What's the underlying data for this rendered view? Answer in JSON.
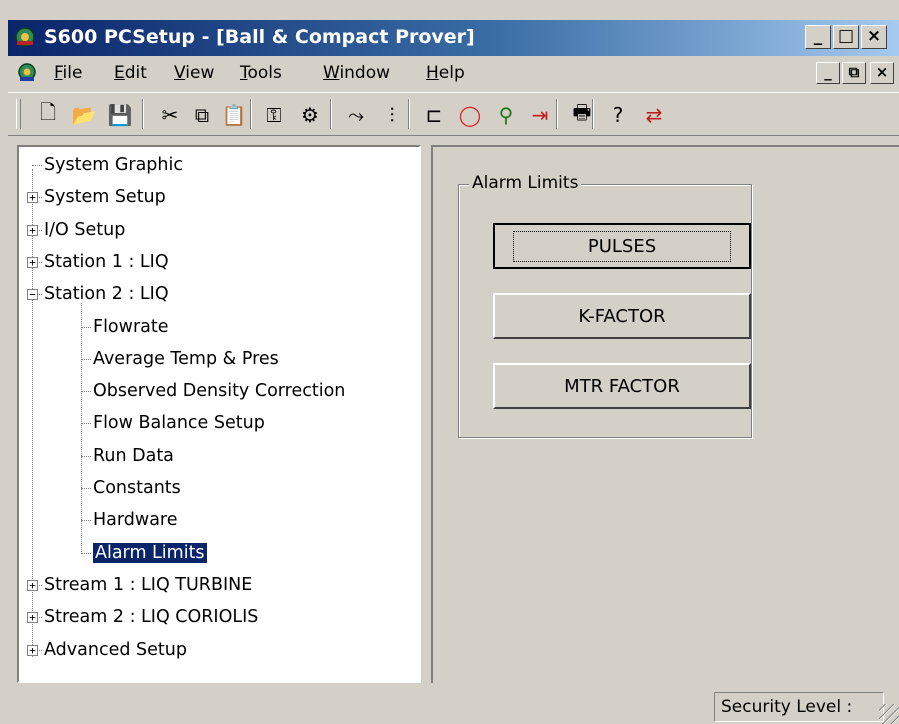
{
  "window": {
    "title": "S600 PCSetup - [Ball & Compact Prover]",
    "controls": [
      "_",
      "□",
      "×"
    ]
  },
  "menubar": {
    "items": [
      {
        "label": "File",
        "accel": "F"
      },
      {
        "label": "Edit",
        "accel": "E"
      },
      {
        "label": "View",
        "accel": "V"
      },
      {
        "label": "Tools",
        "accel": "T"
      },
      {
        "label": "Window",
        "accel": "W"
      },
      {
        "label": "Help",
        "accel": "H"
      }
    ],
    "mdi_controls": [
      "_",
      "⧉",
      "×"
    ]
  },
  "toolbar": {
    "tools": [
      {
        "name": "new-file-icon",
        "glyph": "🗋"
      },
      {
        "name": "open-folder-icon",
        "glyph": "📂"
      },
      {
        "name": "save-icon",
        "glyph": "💾"
      },
      {
        "name": "cut-icon",
        "glyph": "✂"
      },
      {
        "name": "copy-icon",
        "glyph": "⧉"
      },
      {
        "name": "paste-icon",
        "glyph": "📋"
      },
      {
        "name": "key-icon",
        "glyph": "⚿"
      },
      {
        "name": "connect-icon",
        "glyph": "⚙"
      },
      {
        "name": "network-icon",
        "glyph": "⤳"
      },
      {
        "name": "sliders-icon",
        "glyph": "⫶"
      },
      {
        "name": "plug-icon",
        "glyph": "⊏"
      },
      {
        "name": "ring-icon",
        "glyph": "◯"
      },
      {
        "name": "signal-icon",
        "glyph": "⚲"
      },
      {
        "name": "arrow-bar-icon",
        "glyph": "⇥"
      },
      {
        "name": "print-icon",
        "glyph": "🖶"
      },
      {
        "name": "help-icon",
        "glyph": "?"
      },
      {
        "name": "transfer-icon",
        "glyph": "⇄"
      }
    ]
  },
  "tree": {
    "items": [
      {
        "label": "System Graphic",
        "level": 0,
        "expander": ""
      },
      {
        "label": "System Setup",
        "level": 0,
        "expander": "+"
      },
      {
        "label": "I/O Setup",
        "level": 0,
        "expander": "+"
      },
      {
        "label": "Station 1 : LIQ",
        "level": 0,
        "expander": "+"
      },
      {
        "label": "Station 2 : LIQ",
        "level": 0,
        "expander": "−"
      },
      {
        "label": "Flowrate",
        "level": 1,
        "expander": ""
      },
      {
        "label": "Average Temp & Pres",
        "level": 1,
        "expander": ""
      },
      {
        "label": "Observed Density Correction",
        "level": 1,
        "expander": ""
      },
      {
        "label": "Flow Balance Setup",
        "level": 1,
        "expander": ""
      },
      {
        "label": "Run Data",
        "level": 1,
        "expander": ""
      },
      {
        "label": "Constants",
        "level": 1,
        "expander": ""
      },
      {
        "label": "Hardware",
        "level": 1,
        "expander": ""
      },
      {
        "label": "Alarm Limits",
        "level": 1,
        "expander": "",
        "selected": true
      },
      {
        "label": "Stream 1 : LIQ TURBINE",
        "level": 0,
        "expander": "+"
      },
      {
        "label": "Stream 2 : LIQ CORIOLIS",
        "level": 0,
        "expander": "+"
      },
      {
        "label": "Advanced Setup",
        "level": 0,
        "expander": "+"
      }
    ]
  },
  "panel": {
    "group_label": "Alarm Limits",
    "buttons": [
      "PULSES",
      "K-FACTOR",
      "MTR FACTOR"
    ]
  },
  "statusbar": {
    "security_label": "Security Level :"
  },
  "colors": {
    "title_active": "#0a246a",
    "face": "#d4d0c8",
    "selection": "#0a246a"
  }
}
